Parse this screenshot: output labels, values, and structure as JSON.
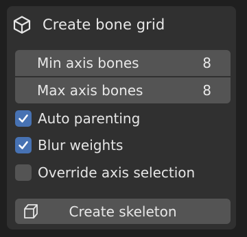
{
  "panel": {
    "title": "Create bone grid",
    "title_icon": "cube-icon"
  },
  "fields": [
    {
      "label": "Min axis bones",
      "value": "8"
    },
    {
      "label": "Max axis bones",
      "value": "8"
    }
  ],
  "options": [
    {
      "label": "Auto parenting",
      "checked": true
    },
    {
      "label": "Blur weights",
      "checked": true
    },
    {
      "label": "Override axis selection",
      "checked": false
    }
  ],
  "action": {
    "label": "Create skeleton",
    "icon": "cube-outline-icon"
  },
  "colors": {
    "accent": "#4772b3",
    "panel_bg": "#303030",
    "widget_bg": "#545454",
    "text": "#e6e6e6"
  }
}
